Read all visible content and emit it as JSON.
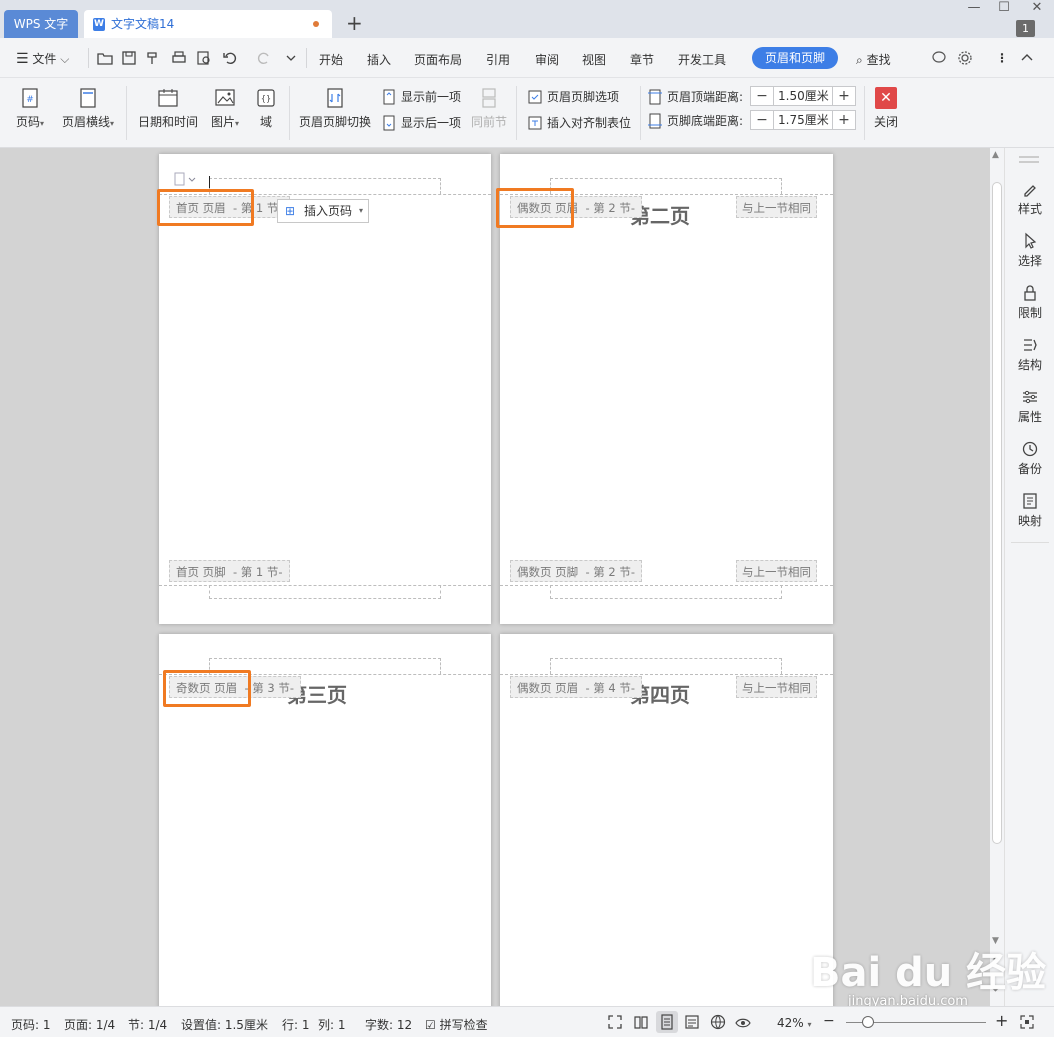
{
  "titlebar": {
    "app_tab": "WPS 文字",
    "doc_tab": "文字文稿14",
    "doc_icon": "W",
    "new_tab": "+",
    "page_badge": "1"
  },
  "menubar": {
    "file": "文件",
    "items": [
      "开始",
      "插入",
      "页面布局",
      "引用",
      "审阅",
      "视图",
      "章节",
      "开发工具"
    ],
    "active": "页眉和页脚",
    "search": "查找"
  },
  "ribbon": {
    "page_number": "页码",
    "header_line": "页眉横线",
    "date_time": "日期和时间",
    "picture": "图片",
    "field": "域",
    "switch_hf": "页眉页脚切换",
    "show_prev": "显示前一项",
    "show_next": "显示后一项",
    "same_as_prev": "同前节",
    "hf_options": "页眉页脚选项",
    "insert_align_tab": "插入对齐制表位",
    "header_top_label": "页眉顶端距离:",
    "header_top_value": "1.50厘米",
    "footer_bottom_label": "页脚底端距离:",
    "footer_bottom_value": "1.75厘米",
    "close": "关闭"
  },
  "pages": {
    "p1": {
      "header_tag": "首页 页眉",
      "header_section": "- 第 1 节-",
      "footer_tag": "首页 页脚",
      "footer_section": "- 第 1 节-",
      "insert_page_number": "插入页码"
    },
    "p2": {
      "title": "第二页",
      "header_tag": "偶数页 页眉",
      "header_section": "- 第 2 节-",
      "same_as_prev": "与上一节相同",
      "footer_tag": "偶数页 页脚",
      "footer_section": "- 第 2 节-",
      "footer_same": "与上一节相同"
    },
    "p3": {
      "title": "第三页",
      "header_tag": "奇数页 页眉",
      "header_section": "- 第 3 节-"
    },
    "p4": {
      "title": "第四页",
      "header_tag": "偶数页 页眉",
      "header_section": "- 第 4 节-",
      "same_as_prev": "与上一节相同"
    }
  },
  "right_panel": [
    "样式",
    "选择",
    "限制",
    "结构",
    "属性",
    "备份",
    "映射"
  ],
  "statusbar": {
    "page_no": "页码: 1",
    "pages": "页面: 1/4",
    "section": "节: 1/4",
    "setting": "设置值: 1.5厘米",
    "row": "行: 1",
    "col": "列: 1",
    "words": "字数: 12",
    "spell": "拼写检查",
    "zoom": "42%",
    "zoom_level": 0.42
  },
  "watermark": {
    "logo": "Bai du 经验",
    "url": "jingyan.baidu.com"
  },
  "colors": {
    "accent": "#3d7ee6",
    "highlight": "#f07a22",
    "apptab": "#5a8ad6",
    "close_red": "#e04848"
  }
}
